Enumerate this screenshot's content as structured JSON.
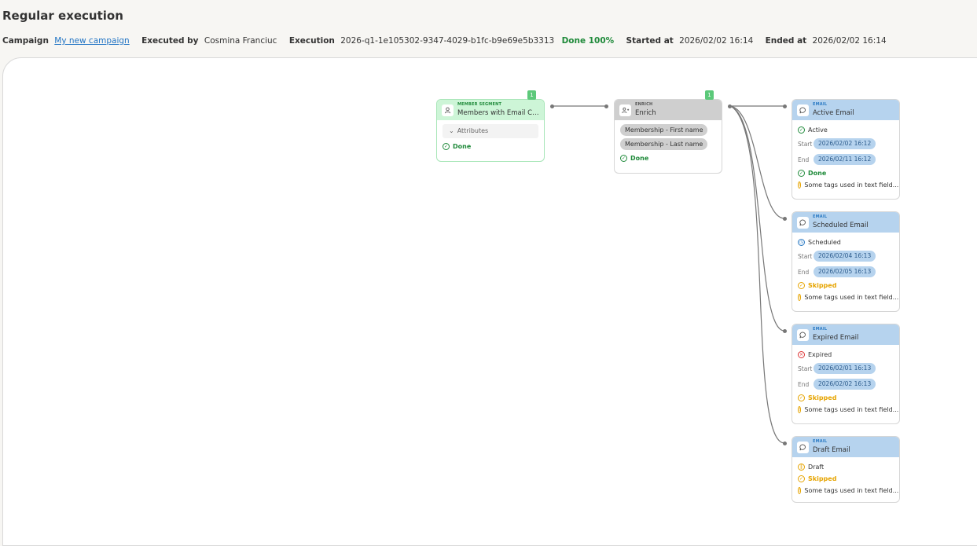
{
  "page": {
    "title": "Regular execution"
  },
  "meta": {
    "campaign_label": "Campaign",
    "campaign_value": "My new campaign",
    "executed_by_label": "Executed by",
    "executed_by_value": "Cosmina Franciuc",
    "execution_label": "Execution",
    "execution_value": "2026-q1-1e105302-9347-4029-b1fc-b9e69e5b3313",
    "status": "Done 100%",
    "started_label": "Started at",
    "started_value": "2026/02/02 16:14",
    "ended_label": "Ended at",
    "ended_value": "2026/02/02 16:14"
  },
  "segment": {
    "badge": "1",
    "type": "MEMBER SEGMENT",
    "name": "Members with Email Con...",
    "attributes": "Attributes",
    "status": "Done",
    "icon": "person-icon"
  },
  "enrich": {
    "badge": "1",
    "type": "ENRICH",
    "name": "Enrich",
    "fields": [
      "Membership - First name",
      "Membership - Last name"
    ],
    "status": "Done",
    "icon": "people-icon"
  },
  "emails": [
    {
      "type": "EMAIL",
      "name": "Active Email",
      "state": "Active",
      "start_label": "Start",
      "start": "2026/02/02 16:12",
      "end_label": "End",
      "end": "2026/02/11 16:12",
      "status": "Done",
      "warning": "Some tags used in text field..."
    },
    {
      "type": "EMAIL",
      "name": "Scheduled Email",
      "state": "Scheduled",
      "start_label": "Start",
      "start": "2026/02/04 16:13",
      "end_label": "End",
      "end": "2026/02/05 16:13",
      "status": "Skipped",
      "warning": "Some tags used in text field..."
    },
    {
      "type": "EMAIL",
      "name": "Expired Email",
      "state": "Expired",
      "start_label": "Start",
      "start": "2026/02/01 16:13",
      "end_label": "End",
      "end": "2026/02/02 16:13",
      "status": "Skipped",
      "warning": "Some tags used in text field..."
    },
    {
      "type": "EMAIL",
      "name": "Draft Email",
      "state": "Draft",
      "status": "Skipped",
      "warning": "Some tags used in text field..."
    }
  ],
  "colors": {
    "done": "#1f8a3a",
    "skipped": "#e6a400",
    "expired": "#d33",
    "scheduled": "#2c7bc4",
    "link": "#1f73c4"
  }
}
